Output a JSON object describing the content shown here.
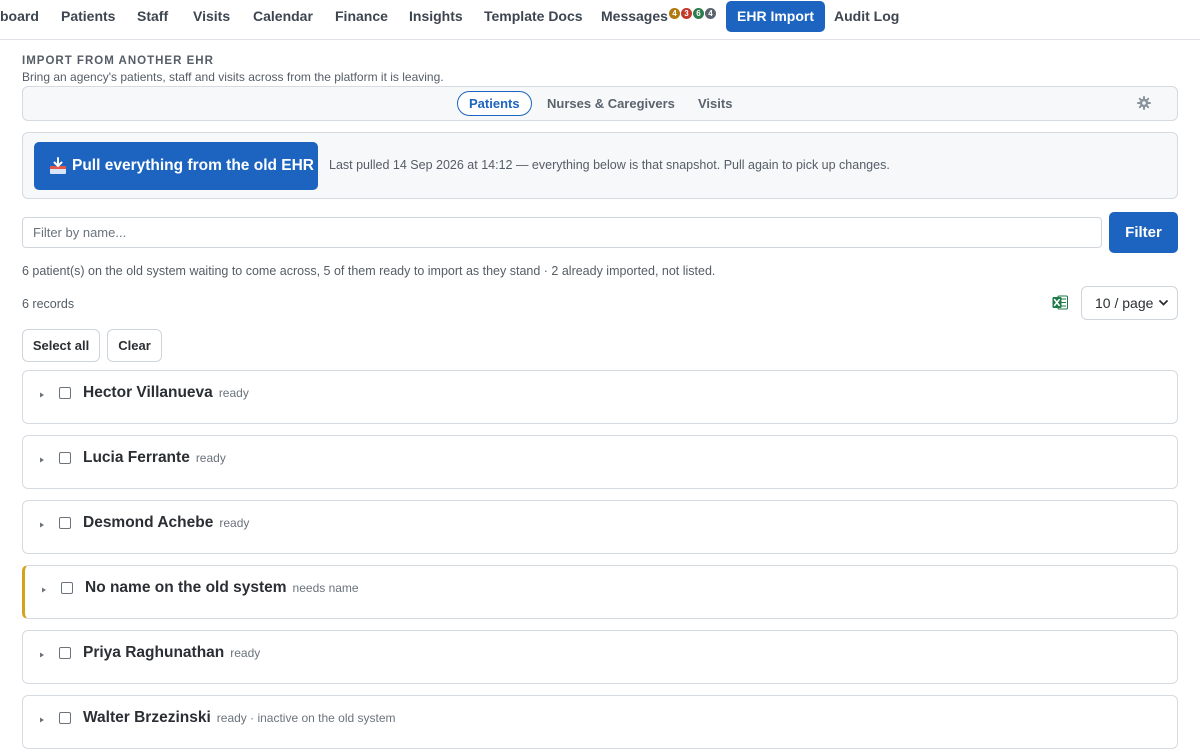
{
  "nav": {
    "items": [
      {
        "label": "board"
      },
      {
        "label": "Patients"
      },
      {
        "label": "Staff"
      },
      {
        "label": "Visits"
      },
      {
        "label": "Calendar"
      },
      {
        "label": "Finance"
      },
      {
        "label": "Insights"
      },
      {
        "label": "Template Docs"
      },
      {
        "label": "Messages"
      },
      {
        "label": "EHR Import"
      },
      {
        "label": "Audit Log"
      }
    ],
    "active": "EHR Import",
    "message_badges": [
      {
        "count": "4",
        "color": "#b07a10"
      },
      {
        "count": "3",
        "color": "#c0392b"
      },
      {
        "count": "6",
        "color": "#2e7d4f"
      },
      {
        "count": "4",
        "color": "#5b646e"
      }
    ]
  },
  "header": {
    "title": "IMPORT FROM ANOTHER EHR",
    "subtitle": "Bring an agency's patients, staff and visits across from the platform it is leaving."
  },
  "tabs": {
    "items": [
      {
        "label": "Patients"
      },
      {
        "label": "Nurses & Caregivers"
      },
      {
        "label": "Visits"
      }
    ],
    "active": "Patients",
    "settings_icon": "gear-icon"
  },
  "pull": {
    "button_label": "Pull everything from the old EHR",
    "button_icon": "inbox-tray-icon",
    "status": "Last pulled 14 Sep 2026 at 14:12 — everything below is that snapshot. Pull again to pick up changes."
  },
  "filter": {
    "placeholder": "Filter by name...",
    "value": "",
    "button_label": "Filter"
  },
  "summary": "6 patient(s) on the old system waiting to come across, 5 of them ready to import as they stand · 2 already imported, not listed.",
  "records_count": "6 records",
  "export_icon": "excel-icon",
  "page_size": {
    "selected": "10 / page"
  },
  "bulk": {
    "select_all_label": "Select all",
    "clear_label": "Clear"
  },
  "colors": {
    "accent": "#1c64c0",
    "warning": "#d6a21c"
  },
  "patients": [
    {
      "name": "Hector Villanueva",
      "status": "ready",
      "checked": false,
      "warning": false
    },
    {
      "name": "Lucia Ferrante",
      "status": "ready",
      "checked": false,
      "warning": false
    },
    {
      "name": "Desmond Achebe",
      "status": "ready",
      "checked": false,
      "warning": false
    },
    {
      "name": "No name on the old system",
      "status": "needs name",
      "checked": false,
      "warning": true
    },
    {
      "name": "Priya Raghunathan",
      "status": "ready",
      "checked": false,
      "warning": false
    },
    {
      "name": "Walter Brzezinski",
      "status": "ready · inactive on the old system",
      "checked": false,
      "warning": false
    }
  ]
}
